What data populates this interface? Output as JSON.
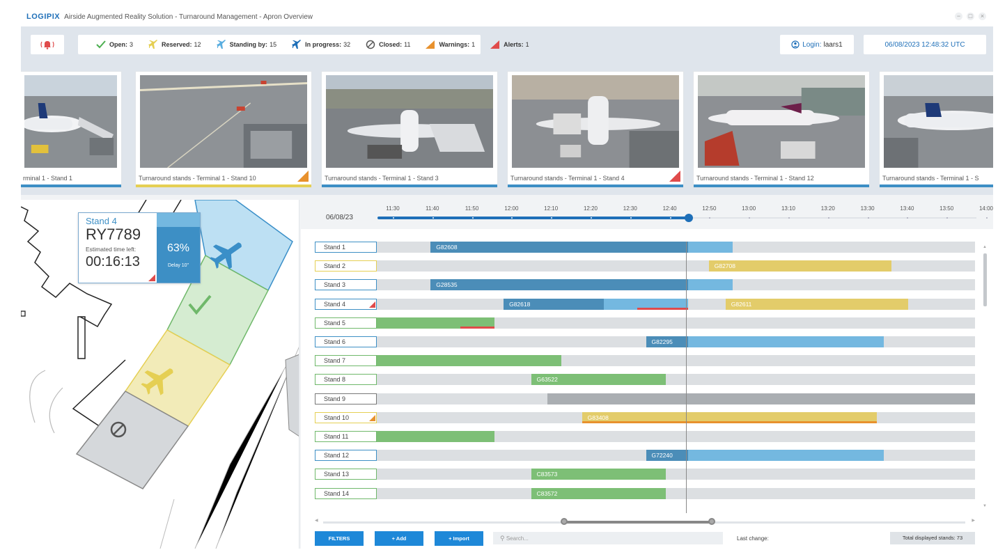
{
  "window": {
    "logo": "LOGIPIX",
    "title": "Airside Augmented Reality Solution - Turnaround Management - Apron Overview",
    "controls": [
      "−",
      "□",
      "×"
    ]
  },
  "status": {
    "alarm_icon": "alarm-bell-icon",
    "items": [
      {
        "icon": "check-icon",
        "label": "Open:",
        "value": "3",
        "color": "#4caf50"
      },
      {
        "icon": "plane-icon",
        "label": "Reserved:",
        "value": "12",
        "color": "#e5cf53"
      },
      {
        "icon": "plane-icon",
        "label": "Standing by:",
        "value": "15",
        "color": "#5aaee0"
      },
      {
        "icon": "plane-icon",
        "label": "In progress:",
        "value": "32",
        "color": "#1e6fb8"
      },
      {
        "icon": "prohibited-icon",
        "label": "Closed:",
        "value": "11",
        "color": "#666666"
      },
      {
        "icon": "warning-icon",
        "label": "Warnings:",
        "value": "1",
        "color": "#e8912d"
      },
      {
        "icon": "alert-icon",
        "label": "Alerts:",
        "value": "1",
        "color": "#e04b4b"
      }
    ],
    "login_label": "Login:",
    "login_user": "laars1",
    "datetime": "06/08/2023 12:48:32 UTC"
  },
  "cameras": [
    {
      "caption": "rminal 1 - Stand 1",
      "bar": "blue",
      "alert": null
    },
    {
      "caption": "Turnaround stands - Terminal 1 - Stand 10",
      "bar": "yellow",
      "alert": "warning"
    },
    {
      "caption": "Turnaround stands - Terminal 1 - Stand 3",
      "bar": "blue",
      "alert": null
    },
    {
      "caption": "Turnaround stands - Terminal 1 - Stand 4",
      "bar": "blue",
      "alert": "alert"
    },
    {
      "caption": "Turnaround stands - Terminal 1 - Stand 12",
      "bar": "blue",
      "alert": null
    },
    {
      "caption": "Turnaround stands - Terminal 1 - S",
      "bar": "blue",
      "alert": null
    }
  ],
  "stand_card": {
    "stand": "Stand 4",
    "flight": "RY7789",
    "est_label": "Estimated time left:",
    "time_left": "00:16:13",
    "percent": "63%",
    "delay": "Delay 10\""
  },
  "timeline": {
    "date": "06/08/23",
    "ticks": [
      "11:30",
      "11:40",
      "11:50",
      "12:00",
      "12:10",
      "12:20",
      "12:30",
      "12:40",
      "12:50",
      "13:00",
      "13:10",
      "13:20",
      "13:30",
      "13:40",
      "13:50",
      "14:00"
    ],
    "progress": 0.52,
    "rows": [
      {
        "stand": "Stand 1",
        "border": "blue",
        "flag": null,
        "segments": [
          {
            "kind": "dark",
            "start": 0.09,
            "end": 0.52,
            "label": "G82608"
          },
          {
            "kind": "light",
            "start": 0.52,
            "end": 0.595,
            "label": ""
          }
        ]
      },
      {
        "stand": "Stand 2",
        "border": "yellow",
        "flag": null,
        "segments": [
          {
            "kind": "yel",
            "start": 0.555,
            "end": 0.86,
            "label": "G82708"
          }
        ]
      },
      {
        "stand": "Stand 3",
        "border": "blue",
        "flag": null,
        "segments": [
          {
            "kind": "dark",
            "start": 0.09,
            "end": 0.52,
            "label": "G28535"
          },
          {
            "kind": "light",
            "start": 0.52,
            "end": 0.595,
            "label": ""
          }
        ]
      },
      {
        "stand": "Stand 4",
        "border": "blue",
        "flag": "alert",
        "segments": [
          {
            "kind": "dark",
            "start": 0.212,
            "end": 0.38,
            "label": "G82618"
          },
          {
            "kind": "light",
            "start": 0.38,
            "end": 0.52,
            "label": ""
          },
          {
            "kind": "red",
            "start": 0.435,
            "end": 0.52,
            "label": ""
          },
          {
            "kind": "yel",
            "start": 0.583,
            "end": 0.888,
            "label": "G82611"
          }
        ]
      },
      {
        "stand": "Stand 5",
        "border": "green",
        "flag": null,
        "segments": [
          {
            "kind": "grn",
            "start": 0.0,
            "end": 0.197,
            "label": ""
          },
          {
            "kind": "red",
            "start": 0.14,
            "end": 0.197,
            "label": ""
          }
        ]
      },
      {
        "stand": "Stand 6",
        "border": "blue",
        "flag": null,
        "segments": [
          {
            "kind": "dark",
            "start": 0.45,
            "end": 0.52,
            "label": "G82295"
          },
          {
            "kind": "light",
            "start": 0.52,
            "end": 0.847,
            "label": ""
          }
        ]
      },
      {
        "stand": "Stand 7",
        "border": "green",
        "flag": null,
        "segments": [
          {
            "kind": "grn",
            "start": 0.0,
            "end": 0.308,
            "label": ""
          }
        ]
      },
      {
        "stand": "Stand 8",
        "border": "green",
        "flag": null,
        "segments": [
          {
            "kind": "grn",
            "start": 0.258,
            "end": 0.483,
            "label": "G63522"
          }
        ]
      },
      {
        "stand": "Stand 9",
        "border": "gray",
        "flag": null,
        "segments": [
          {
            "kind": "gry",
            "start": 0.285,
            "end": 1.0,
            "label": ""
          }
        ]
      },
      {
        "stand": "Stand 10",
        "border": "yellow",
        "flag": "warning",
        "segments": [
          {
            "kind": "yel",
            "start": 0.343,
            "end": 0.836,
            "label": "G83408"
          },
          {
            "kind": "org",
            "start": 0.343,
            "end": 0.836,
            "label": ""
          }
        ]
      },
      {
        "stand": "Stand 11",
        "border": "green",
        "flag": null,
        "segments": [
          {
            "kind": "grn",
            "start": 0.0,
            "end": 0.197,
            "label": ""
          }
        ]
      },
      {
        "stand": "Stand 12",
        "border": "blue",
        "flag": null,
        "segments": [
          {
            "kind": "dark",
            "start": 0.45,
            "end": 0.52,
            "label": "G72240"
          },
          {
            "kind": "light",
            "start": 0.52,
            "end": 0.847,
            "label": ""
          }
        ]
      },
      {
        "stand": "Stand 13",
        "border": "green",
        "flag": null,
        "segments": [
          {
            "kind": "grn",
            "start": 0.258,
            "end": 0.483,
            "label": "C83573"
          }
        ]
      },
      {
        "stand": "Stand 14",
        "border": "green",
        "flag": null,
        "segments": [
          {
            "kind": "grn",
            "start": 0.258,
            "end": 0.483,
            "label": "C83572"
          }
        ]
      }
    ]
  },
  "footer": {
    "filters": "FILTERS",
    "add": "+ Add",
    "import": "+ Import",
    "search_placeholder": "Search...",
    "last_change_label": "Last change:",
    "total": "Total displayed stands: 73"
  }
}
